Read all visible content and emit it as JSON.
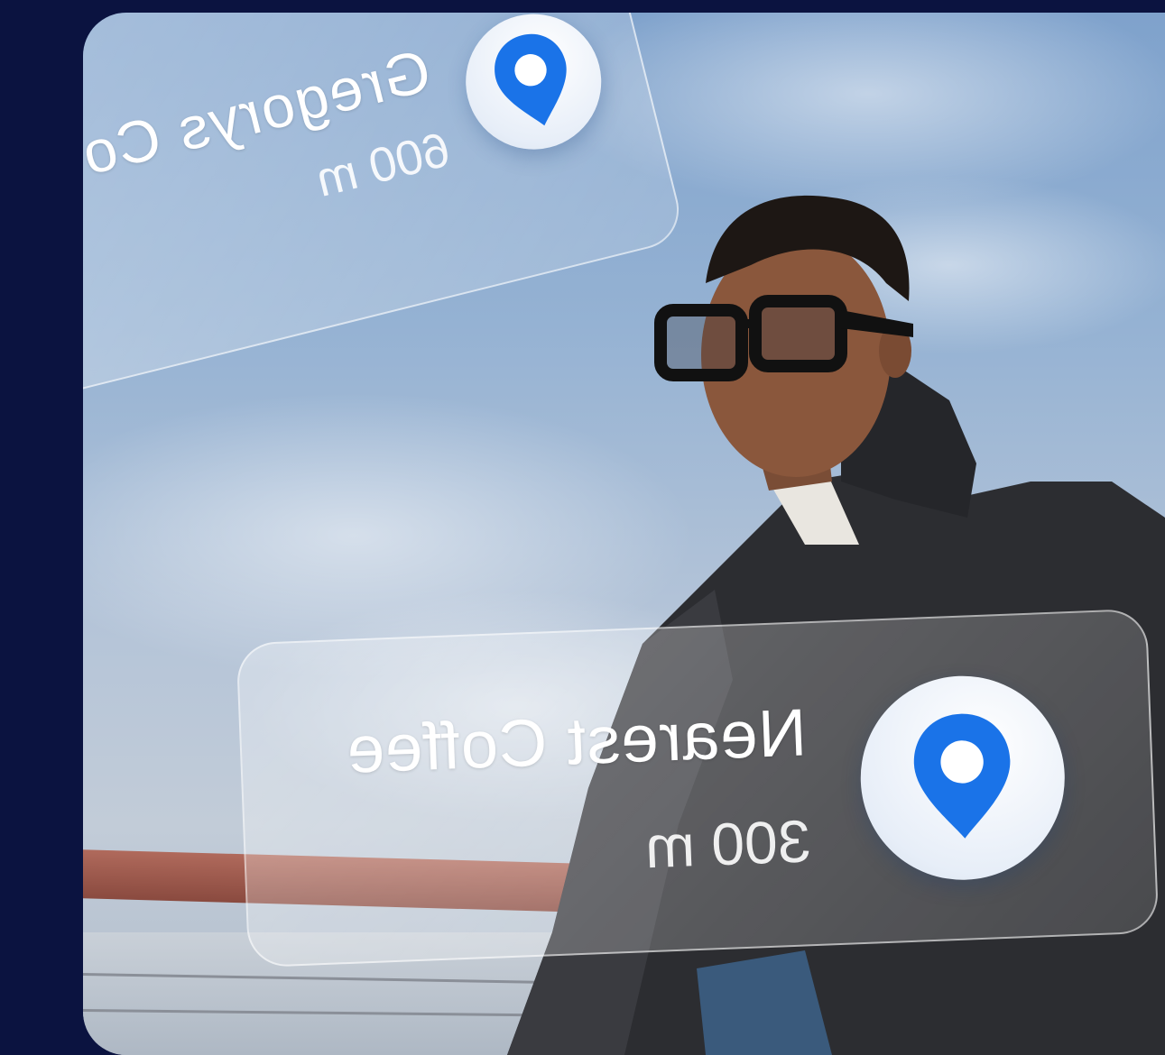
{
  "scene": {
    "description_icon": "person-with-smart-glasses",
    "colors": {
      "page_background": "#0b1340",
      "pin_blue": "#1a73e8"
    }
  },
  "cards": [
    {
      "id": "top",
      "title": "Gregorys Co",
      "distance": "600 m",
      "icon": "location-pin-icon",
      "mirrored": true
    },
    {
      "id": "bottom",
      "title": "Nearest Coffee",
      "distance": "300 m",
      "icon": "location-pin-icon",
      "mirrored": true
    }
  ]
}
